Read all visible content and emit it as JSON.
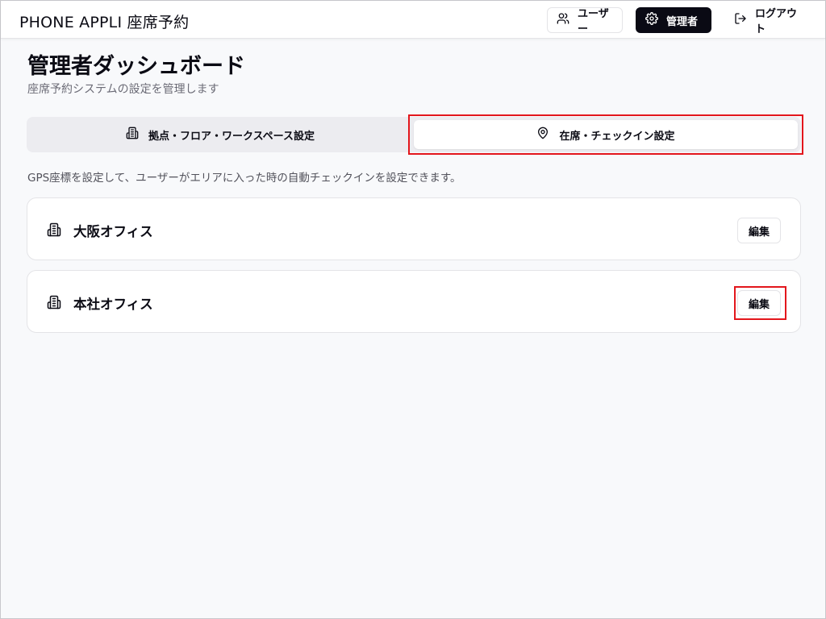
{
  "header": {
    "app_title": "PHONE APPLI 座席予約",
    "users_label": "ユーザー",
    "admin_label": "管理者",
    "logout_label": "ログアウト"
  },
  "page": {
    "title": "管理者ダッシュボード",
    "subtitle": "座席予約システムの設定を管理します"
  },
  "tabs": [
    {
      "label": "拠点・フロア・ワークスペース設定",
      "icon": "building-icon",
      "selected": false
    },
    {
      "label": "在席・チェックイン設定",
      "icon": "map-pin-icon",
      "selected": true
    }
  ],
  "description": "GPS座標を設定して、ユーザーがエリアに入った時の自動チェックインを設定できます。",
  "offices": [
    {
      "name": "大阪オフィス",
      "icon": "building-icon",
      "edit_label": "編集"
    },
    {
      "name": "本社オフィス",
      "icon": "building-icon",
      "edit_label": "編集"
    }
  ],
  "colors": {
    "accent_dark": "#0a0a14",
    "highlight_red": "#e3161c",
    "background": "#f8f9fb"
  }
}
